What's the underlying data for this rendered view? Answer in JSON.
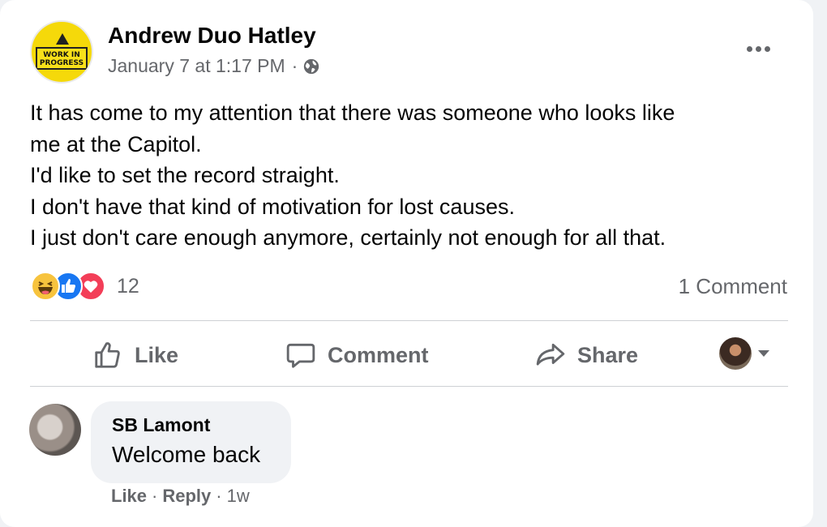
{
  "post": {
    "author": "Andrew Duo Hatley",
    "timestamp": "January 7 at 1:17 PM",
    "separator": "·",
    "avatar_sign": "WORK IN PROGRESS",
    "audience_icon": "globe-icon",
    "text_lines": [
      "It has come to my attention that there was someone who looks like",
      "me at the Capitol.",
      "I'd like to set the record straight.",
      "I don't have that kind of motivation for lost causes.",
      "I just don't care enough anymore, certainly not enough for all that."
    ]
  },
  "reactions": {
    "icons": [
      "haha-icon",
      "like-icon",
      "love-icon"
    ],
    "count": "12",
    "comments": "1 Comment"
  },
  "actions": {
    "like": "Like",
    "comment": "Comment",
    "share": "Share"
  },
  "comment": {
    "name": "SB Lamont",
    "text": "Welcome back",
    "like": "Like",
    "reply": "Reply",
    "time": "1w",
    "separator": "·"
  },
  "colors": {
    "secondary_text": "#65676b",
    "like_blue": "#1877f2",
    "love_red": "#f33e58",
    "haha_yellow": "#f7c33d"
  }
}
